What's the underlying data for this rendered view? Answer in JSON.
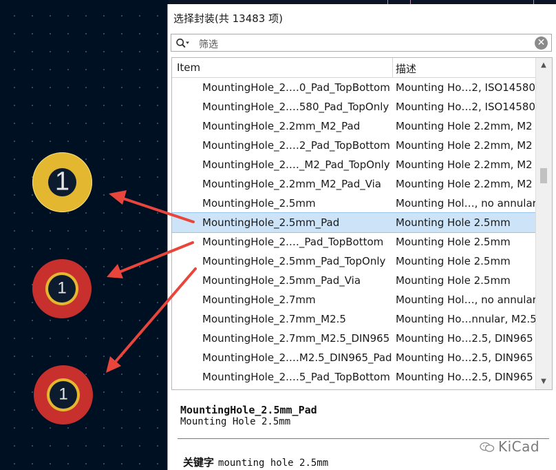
{
  "dialog": {
    "title": "选择封装(共 13483 项)",
    "filter_placeholder": "筛选",
    "columns": {
      "item": "Item",
      "description": "描述"
    },
    "rows": [
      {
        "item": "MountingHole_2.…0_Pad_TopBottom",
        "desc": "Mounting Ho…2, ISO14580",
        "selected": false
      },
      {
        "item": "MountingHole_2.…580_Pad_TopOnly",
        "desc": "Mounting Ho…2, ISO14580",
        "selected": false
      },
      {
        "item": "MountingHole_2.2mm_M2_Pad",
        "desc": "Mounting Hole 2.2mm, M2",
        "selected": false
      },
      {
        "item": "MountingHole_2.…2_Pad_TopBottom",
        "desc": "Mounting Hole 2.2mm, M2",
        "selected": false
      },
      {
        "item": "MountingHole_2.…_M2_Pad_TopOnly",
        "desc": "Mounting Hole 2.2mm, M2",
        "selected": false
      },
      {
        "item": "MountingHole_2.2mm_M2_Pad_Via",
        "desc": "Mounting Hole 2.2mm, M2",
        "selected": false
      },
      {
        "item": "MountingHole_2.5mm",
        "desc": "Mounting Hol…, no annular",
        "selected": false
      },
      {
        "item": "MountingHole_2.5mm_Pad",
        "desc": "Mounting Hole 2.5mm",
        "selected": true
      },
      {
        "item": "MountingHole_2.…_Pad_TopBottom",
        "desc": "Mounting Hole 2.5mm",
        "selected": false
      },
      {
        "item": "MountingHole_2.5mm_Pad_TopOnly",
        "desc": "Mounting Hole 2.5mm",
        "selected": false
      },
      {
        "item": "MountingHole_2.5mm_Pad_Via",
        "desc": "Mounting Hole 2.5mm",
        "selected": false
      },
      {
        "item": "MountingHole_2.7mm",
        "desc": "Mounting Hol…, no annular",
        "selected": false
      },
      {
        "item": "MountingHole_2.7mm_M2.5",
        "desc": "Mounting Ho…nnular, M2.5",
        "selected": false
      },
      {
        "item": "MountingHole_2.7mm_M2.5_DIN965",
        "desc": "Mounting Ho…2.5, DIN965",
        "selected": false
      },
      {
        "item": "MountingHole_2.…M2.5_DIN965_Pad",
        "desc": "Mounting Ho…2.5, DIN965",
        "selected": false
      },
      {
        "item": "MountingHole_2.…5_Pad_TopBottom",
        "desc": "Mounting Ho…2.5, DIN965",
        "selected": false
      }
    ]
  },
  "details": {
    "name": "MountingHole_2.5mm_Pad",
    "description": "Mounting Hole 2.5mm",
    "keywords_label": "关键字",
    "keywords": "mounting hole 2.5mm"
  },
  "watermark": "KiCad",
  "pads": [
    {
      "label": "1"
    },
    {
      "label": "1"
    },
    {
      "label": "1"
    }
  ],
  "colors": {
    "board_bg": "#001023",
    "pad_gold": "#e3b830",
    "pad_red": "#c8302e",
    "selection": "#cde3f7",
    "arrow": "#e8463c"
  }
}
